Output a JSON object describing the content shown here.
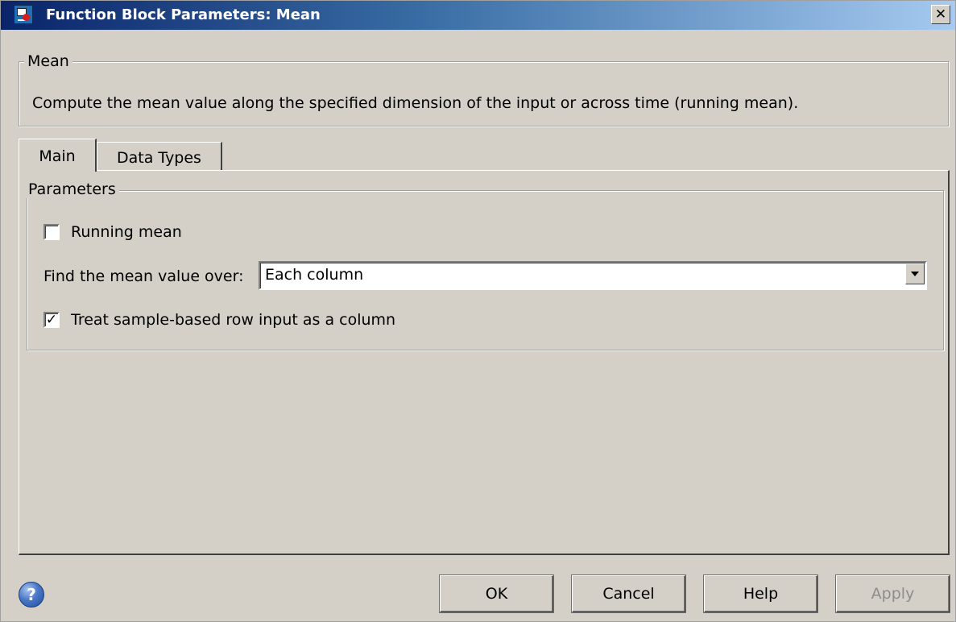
{
  "window": {
    "title": "Function Block Parameters: Mean",
    "close_glyph": "✕"
  },
  "description_group": {
    "legend": "Mean",
    "text": "Compute the mean value along the specified dimension of the input or across time (running mean)."
  },
  "tabs": [
    {
      "label": "Main",
      "active": true
    },
    {
      "label": "Data Types",
      "active": false
    }
  ],
  "parameters": {
    "legend": "Parameters",
    "running_mean": {
      "label": "Running mean",
      "checked": false
    },
    "mean_over": {
      "label": "Find the mean value over:",
      "value": "Each column"
    },
    "treat_row_as_column": {
      "label": "Treat sample-based row input as a column",
      "checked": true,
      "check_glyph": "✓"
    }
  },
  "buttons": {
    "help_icon_glyph": "?",
    "ok": "OK",
    "cancel": "Cancel",
    "help": "Help",
    "apply": "Apply"
  },
  "icons": {
    "app": "simulink-block-icon",
    "help": "help-icon",
    "close": "close-icon",
    "dropdown": "chevron-down-icon"
  },
  "colors": {
    "title_gradient_start": "#0a246a",
    "title_gradient_end": "#a6caf0",
    "face": "#d4d0c8",
    "disabled_text": "#8d8d8d"
  }
}
